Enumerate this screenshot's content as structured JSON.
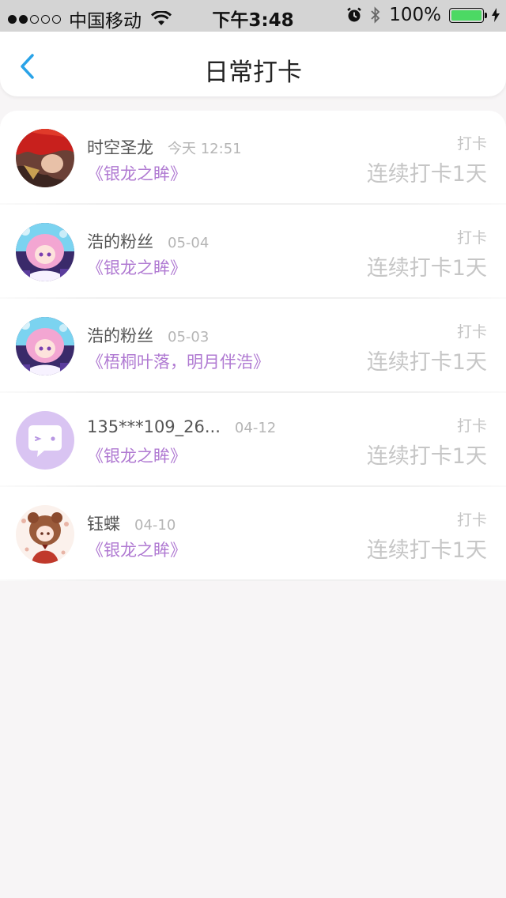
{
  "status_bar": {
    "carrier": "中国移动",
    "time": "下午3:48",
    "battery": "100%",
    "signal_bars_filled": 2,
    "signal_bars_total": 5,
    "battery_color": "#4cd964"
  },
  "nav": {
    "title": "日常打卡",
    "back_icon": "chevron-left-icon",
    "accent_color": "#2aa3e8"
  },
  "list": {
    "items": [
      {
        "name": "时空圣龙",
        "date": "今天 12:51",
        "book": "《银龙之眸》",
        "checkin_label": "打卡",
        "streak": "连续打卡1天",
        "avatar": "red-hair-character-avatar"
      },
      {
        "name": "浩的粉丝",
        "date": "05-04",
        "book": "《银龙之眸》",
        "checkin_label": "打卡",
        "streak": "连续打卡1天",
        "avatar": "pink-hair-anime-avatar"
      },
      {
        "name": "浩的粉丝",
        "date": "05-03",
        "book": "《梧桐叶落，明月伴浩》",
        "checkin_label": "打卡",
        "streak": "连续打卡1天",
        "avatar": "pink-hair-anime-avatar"
      },
      {
        "name": "135***109_26...",
        "date": "04-12",
        "book": "《银龙之眸》",
        "checkin_label": "打卡",
        "streak": "连续打卡1天",
        "avatar": "default-chat-bubble-avatar"
      },
      {
        "name": "钰蝶",
        "date": "04-10",
        "book": "《银龙之眸》",
        "checkin_label": "打卡",
        "streak": "连续打卡1天",
        "avatar": "brown-hair-anime-avatar"
      }
    ]
  },
  "colors": {
    "book_title": "#b07ad2",
    "muted_text": "#c6c6c6",
    "background": "#f7f5f6"
  }
}
